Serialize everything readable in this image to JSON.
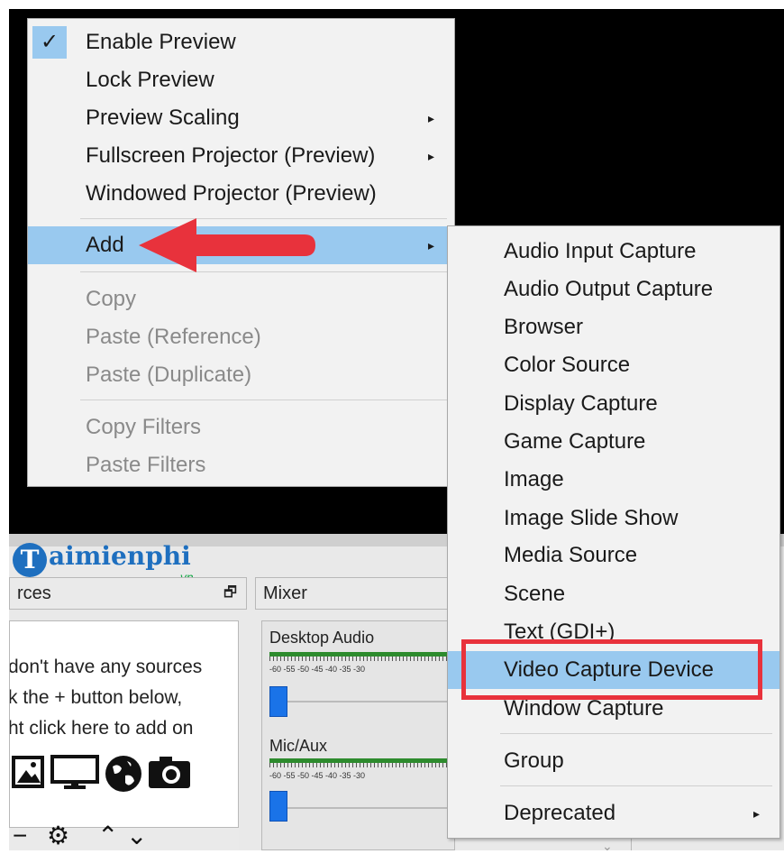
{
  "main_menu": {
    "items": [
      {
        "label": "Enable Preview",
        "checked": true,
        "disabled": false,
        "submenu": false
      },
      {
        "label": "Lock Preview",
        "checked": false,
        "disabled": false,
        "submenu": false
      },
      {
        "label": "Preview Scaling",
        "checked": false,
        "disabled": false,
        "submenu": true
      },
      {
        "label": "Fullscreen Projector (Preview)",
        "checked": false,
        "disabled": false,
        "submenu": true
      },
      {
        "label": "Windowed Projector (Preview)",
        "checked": false,
        "disabled": false,
        "submenu": false
      },
      {
        "label": "Add",
        "checked": false,
        "disabled": false,
        "submenu": true,
        "highlighted": true
      },
      {
        "label": "Copy",
        "checked": false,
        "disabled": true,
        "submenu": false
      },
      {
        "label": "Paste (Reference)",
        "checked": false,
        "disabled": true,
        "submenu": false
      },
      {
        "label": "Paste (Duplicate)",
        "checked": false,
        "disabled": true,
        "submenu": false
      },
      {
        "label": "Copy Filters",
        "checked": false,
        "disabled": true,
        "submenu": false
      },
      {
        "label": "Paste Filters",
        "checked": false,
        "disabled": true,
        "submenu": false
      }
    ],
    "check_glyph": "✓",
    "arrow_glyph": "▸"
  },
  "add_submenu": {
    "items": [
      {
        "label": "Audio Input Capture"
      },
      {
        "label": "Audio Output Capture"
      },
      {
        "label": "Browser"
      },
      {
        "label": "Color Source"
      },
      {
        "label": "Display Capture"
      },
      {
        "label": "Game Capture"
      },
      {
        "label": "Image"
      },
      {
        "label": "Image Slide Show"
      },
      {
        "label": "Media Source"
      },
      {
        "label": "Scene"
      },
      {
        "label": "Text (GDI+)"
      },
      {
        "label": "Video Capture Device",
        "highlighted": true
      },
      {
        "label": "Window Capture"
      },
      {
        "label": "Group"
      },
      {
        "label": "Deprecated",
        "submenu": true
      }
    ]
  },
  "sources_panel": {
    "header": "rces",
    "float_icon": "🗗",
    "empty_message": [
      "don't have any sources",
      "k the + button below,",
      "ht click here to add on"
    ],
    "toolbar": {
      "remove": "−",
      "settings": "⚙",
      "up": "⌃",
      "down": "⌄"
    }
  },
  "mixer_panel": {
    "header": "Mixer",
    "channels": [
      {
        "name": "Desktop Audio",
        "scale": "-60 -55 -50 -45 -40 -35 -30"
      },
      {
        "name": "Mic/Aux",
        "scale": "-60 -55 -50 -45 -40 -35 -30"
      }
    ]
  },
  "watermark": {
    "brand": "aimienphi",
    "initial": "T",
    "tld": ".vn"
  },
  "colors": {
    "highlight": "#99c9ef",
    "annotation_red": "#e8323c",
    "brand_blue": "#1e6fbf"
  }
}
